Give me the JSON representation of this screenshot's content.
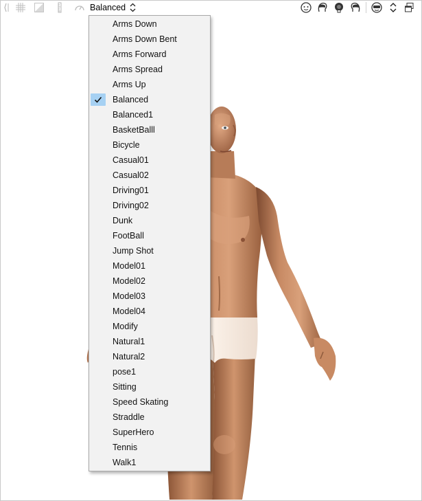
{
  "toolbar": {
    "left_icons": [
      "bracket-icon",
      "grid-icon",
      "background-icon",
      "ruler-icon",
      "gauge-icon"
    ],
    "pose_select": {
      "value": "Balanced",
      "icon": "updown-arrows-icon"
    },
    "right_icons": [
      "face-front-icon",
      "face-left-icon",
      "face-back-icon",
      "face-right-icon",
      "camera-face-icon",
      "updown-arrows-icon",
      "window-icon"
    ]
  },
  "dropdown": {
    "selected": "Balanced",
    "items": [
      "Arms Down",
      "Arms Down Bent",
      "Arms Forward",
      "Arms Spread",
      "Arms Up",
      "Balanced",
      "Balanced1",
      "BasketBalll",
      "Bicycle",
      "Casual01",
      "Casual02",
      "Driving01",
      "Driving02",
      "Dunk",
      "FootBall",
      "Jump Shot",
      "Model01",
      "Model02",
      "Model03",
      "Model04",
      "Modify",
      "Natural1",
      "Natural2",
      "pose1",
      "Sitting",
      "Speed Skating",
      "Straddle",
      "SuperHero",
      "Tennis",
      "Walk1"
    ]
  },
  "colors": {
    "skin": "#c98c67",
    "skin_shadow": "#8f5a3d",
    "underwear": "#f3e7dc",
    "check_highlight": "#a6d1f3",
    "menu_bg": "#f2f2f2"
  }
}
